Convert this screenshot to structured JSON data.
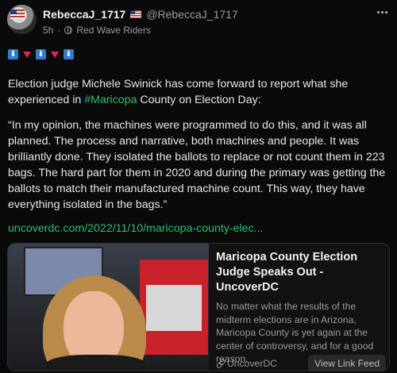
{
  "post": {
    "display_name": "RebeccaJ_1717",
    "flag_icon": "us-flag-emoji",
    "handle": "@RebeccaJ_1717",
    "time": "5h",
    "separator": "·",
    "community": "Red Wave Riders",
    "emoji_sequence": [
      "down-arrow-emoji",
      "red-triangle-emoji",
      "down-arrow-emoji",
      "red-triangle-emoji",
      "down-arrow-emoji"
    ],
    "paragraph1_before": "Election judge Michele Swinick has come forward to report what she experienced in ",
    "hashtag": "#Maricopa",
    "paragraph1_after": " County on Election Day:",
    "paragraph2": "“In my opinion, the machines were programmed to do this, and it was all planned. The process and narrative, both machines and people. It was brilliantly done. They isolated the ballots to replace or not count them in 223 bags. The hard part for them in 2020 and during the primary was getting the ballots to match their manufactured machine count. This way, they have everything isolated in the bags.”",
    "link_text": "uncoverdc.com/2022/11/10/maricopa-county-elec..."
  },
  "card": {
    "title": "Maricopa County Election Judge Speaks Out - UncoverDC",
    "description": "No matter what the results of the midterm elections are in Arizona, Maricopa County is yet again at the center of controversy, and for a good reason.",
    "source": "UncoverDC",
    "button": "View Link Feed"
  },
  "colors": {
    "background": "#0a0a0a",
    "accent_green": "#2fbf71",
    "muted_text": "#9a9a9a"
  }
}
